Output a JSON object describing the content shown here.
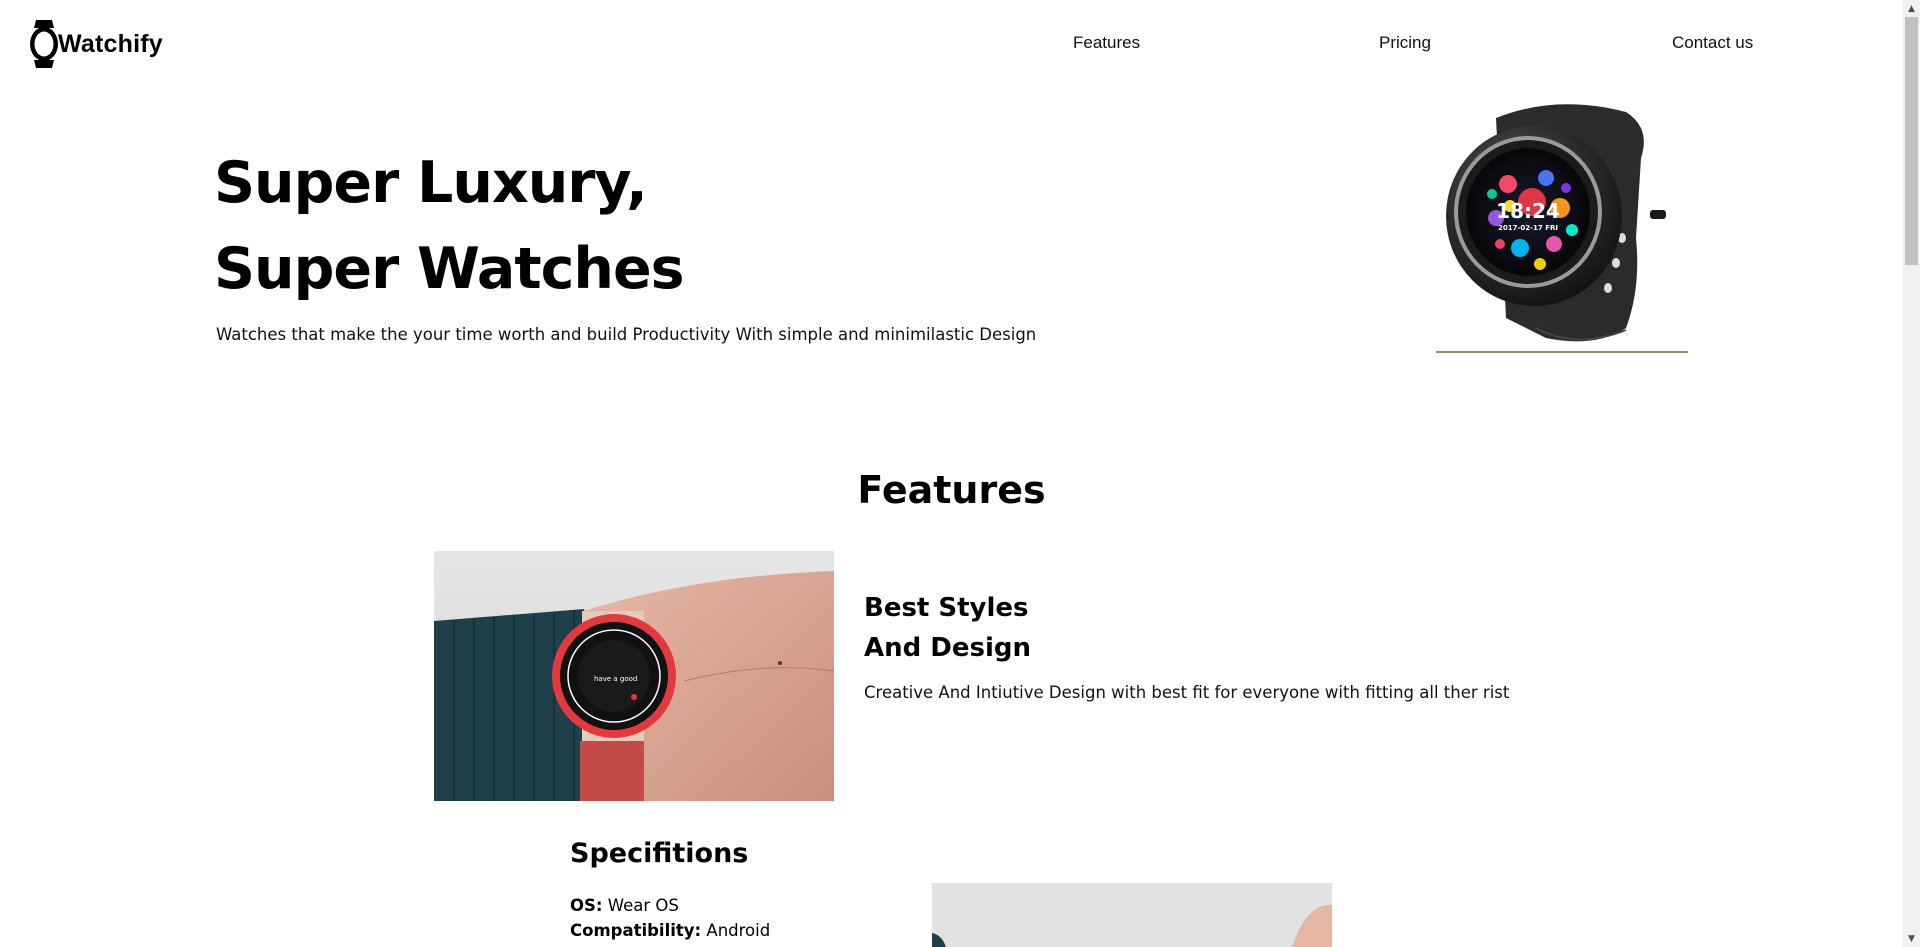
{
  "header": {
    "logo_text": "Watchify",
    "nav": [
      {
        "label": "Features"
      },
      {
        "label": "Pricing"
      },
      {
        "label": "Contact us"
      }
    ]
  },
  "hero": {
    "title_line1": "Super Luxury,",
    "title_line2": "Super Watches",
    "subtitle": "Watches that make the your time worth and build Productivity With simple and minimilastic Design",
    "watch_time": "18:24",
    "watch_date": "2017-02-17 FRI"
  },
  "features": {
    "section_title": "Features",
    "items": [
      {
        "title_line1": "Best Styles",
        "title_line2": "And Design",
        "description": "Creative And Intiutive Design with best fit for everyone with fitting all ther rist",
        "watch_text": "have a good"
      }
    ]
  },
  "specs": {
    "title": "Specifitions",
    "items": [
      {
        "key": "OS:",
        "value": " Wear OS"
      },
      {
        "key": "Compatibility:",
        "value": " Android"
      }
    ]
  },
  "colors": {
    "text": "#000000",
    "background": "#ffffff",
    "scrollbar_track": "#f1f1f1",
    "scrollbar_thumb": "#c1c1c1"
  },
  "icons": {
    "logo": "watch-icon",
    "scroll_up": "triangle-up",
    "scroll_down": "triangle-down"
  }
}
